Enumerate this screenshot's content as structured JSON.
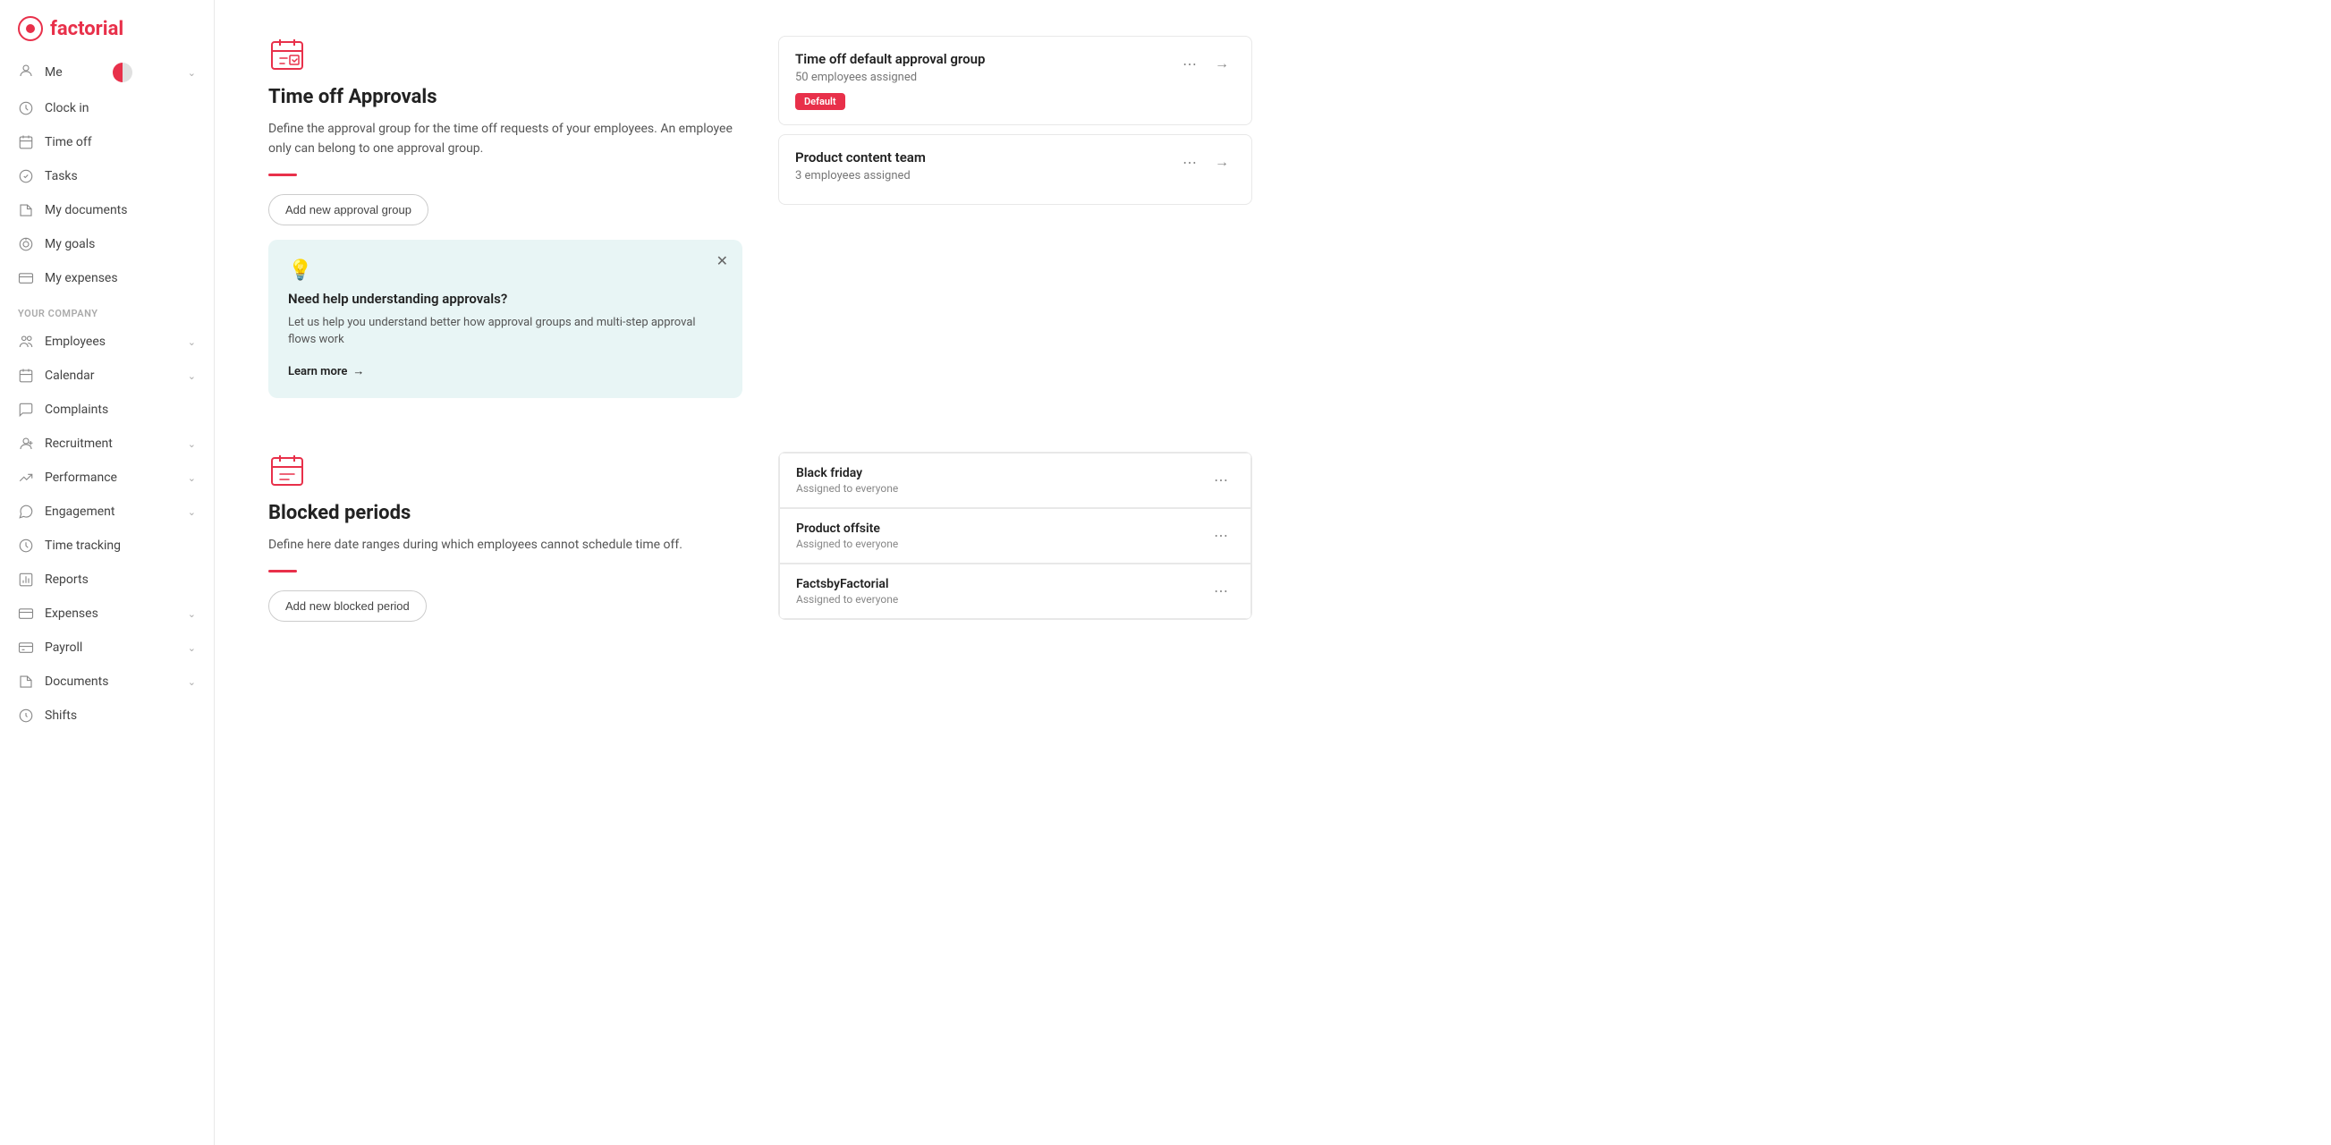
{
  "logo": {
    "text": "factorial"
  },
  "sidebar": {
    "user": {
      "name": "Me",
      "label": "Me"
    },
    "personal_items": [
      {
        "id": "clock-in",
        "label": "Clock in",
        "icon": "clock"
      },
      {
        "id": "time-off",
        "label": "Time off",
        "icon": "calendar"
      },
      {
        "id": "tasks",
        "label": "Tasks",
        "icon": "check-circle"
      },
      {
        "id": "my-documents",
        "label": "My documents",
        "icon": "folder"
      },
      {
        "id": "my-goals",
        "label": "My goals",
        "icon": "target"
      },
      {
        "id": "my-expenses",
        "label": "My expenses",
        "icon": "receipt"
      }
    ],
    "company_section": "YOUR COMPANY",
    "company_items": [
      {
        "id": "employees",
        "label": "Employees",
        "icon": "person",
        "has_chevron": true
      },
      {
        "id": "calendar",
        "label": "Calendar",
        "icon": "calendar2",
        "has_chevron": true
      },
      {
        "id": "complaints",
        "label": "Complaints",
        "icon": "comment"
      },
      {
        "id": "recruitment",
        "label": "Recruitment",
        "icon": "person-add",
        "has_chevron": true
      },
      {
        "id": "performance",
        "label": "Performance",
        "icon": "chart",
        "has_chevron": true
      },
      {
        "id": "engagement",
        "label": "Engagement",
        "icon": "chat",
        "has_chevron": true
      },
      {
        "id": "time-tracking",
        "label": "Time tracking",
        "icon": "clock2"
      },
      {
        "id": "reports",
        "label": "Reports",
        "icon": "bar-chart"
      },
      {
        "id": "expenses",
        "label": "Expenses",
        "icon": "credit-card",
        "has_chevron": true
      },
      {
        "id": "payroll",
        "label": "Payroll",
        "icon": "dollar",
        "has_chevron": true
      },
      {
        "id": "documents",
        "label": "Documents",
        "icon": "file",
        "has_chevron": true
      },
      {
        "id": "shifts",
        "label": "Shifts",
        "icon": "clock3"
      }
    ]
  },
  "approvals_section": {
    "icon_color": "#e8304a",
    "title": "Time off Approvals",
    "description": "Define the approval group for the time off requests of your employees. An employee only can belong to one approval group.",
    "add_button": "Add new approval group",
    "cards": [
      {
        "title": "Time off default approval group",
        "subtitle": "50 employees assigned",
        "badge": "Default",
        "has_badge": true
      },
      {
        "title": "Product content team",
        "subtitle": "3 employees assigned",
        "has_badge": false
      }
    ],
    "info_box": {
      "title": "Need help understanding approvals?",
      "description": "Let us help you understand better how approval groups and multi-step approval flows work",
      "learn_more": "Learn more"
    }
  },
  "blocked_section": {
    "title": "Blocked periods",
    "description": "Define here date ranges during which employees cannot schedule time off.",
    "add_button": "Add new blocked period",
    "cards": [
      {
        "title": "Black friday",
        "subtitle": "Assigned to everyone"
      },
      {
        "title": "Product offsite",
        "subtitle": "Assigned to everyone"
      },
      {
        "title": "FactsbyFactorial",
        "subtitle": "Assigned to everyone"
      }
    ]
  }
}
